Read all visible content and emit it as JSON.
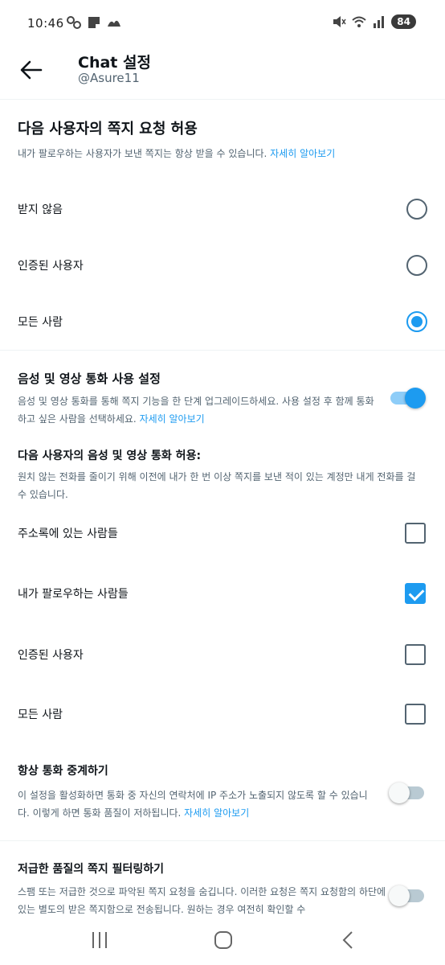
{
  "status_bar": {
    "time": "10:46",
    "battery": "84",
    "left_icons": [
      "app-icon-a",
      "app-icon-b",
      "app-icon-c"
    ],
    "right_icons": [
      "mute-icon",
      "wifi-icon",
      "signal-icon"
    ]
  },
  "header": {
    "title": "Chat 설정",
    "handle": "@Asure11"
  },
  "message_requests": {
    "title": "다음 사용자의 쪽지 요청 허용",
    "description": "내가 팔로우하는 사용자가 보낸 쪽지는 항상 받을 수 있습니다.",
    "learn_more": "자세히 알아보기",
    "options": [
      {
        "label": "받지 않음",
        "selected": false
      },
      {
        "label": "인증된 사용자",
        "selected": false
      },
      {
        "label": "모든 사람",
        "selected": true
      }
    ]
  },
  "calls": {
    "title": "음성 및 영상 통화 사용 설정",
    "description": "음성 및 영상 통화를 통해 쪽지 기능을 한 단계 업그레이드하세요. 사용 설정 후 함께 통화하고 싶은 사람을 선택하세요.",
    "learn_more": "자세히 알아보기",
    "enabled": true,
    "allow_title": "다음 사용자의 음성 및 영상 통화 허용:",
    "allow_description": "원치 않는 전화를 줄이기 위해 이전에 내가 한 번 이상 쪽지를 보낸 적이 있는 계정만 내게 전화를 걸 수 있습니다.",
    "options": [
      {
        "label": "주소록에 있는 사람들",
        "checked": false
      },
      {
        "label": "내가 팔로우하는 사람들",
        "checked": true
      },
      {
        "label": "인증된 사용자",
        "checked": false
      },
      {
        "label": "모든 사람",
        "checked": false
      }
    ]
  },
  "relay": {
    "title": "항상 통화 중계하기",
    "description": "이 설정을 활성화하면 통화 중 자신의 연락처에 IP 주소가 노출되지 않도록 할 수 있습니다. 이렇게 하면 통화 품질이 저하됩니다.",
    "learn_more": "자세히 알아보기",
    "enabled": false
  },
  "filter": {
    "title": "저급한 품질의 쪽지 필터링하기",
    "description": "스팸 또는 저급한 것으로 파악된 쪽지 요청을 숨깁니다. 이러한 요청은 쪽지 요청함의 하단에 있는 별도의 받은 쪽지함으로 전송됩니다. 원하는 경우 여전히 확인할 수",
    "enabled": false
  },
  "colors": {
    "accent": "#1d9bf0",
    "text": "#0f1419",
    "secondary": "#536471"
  }
}
